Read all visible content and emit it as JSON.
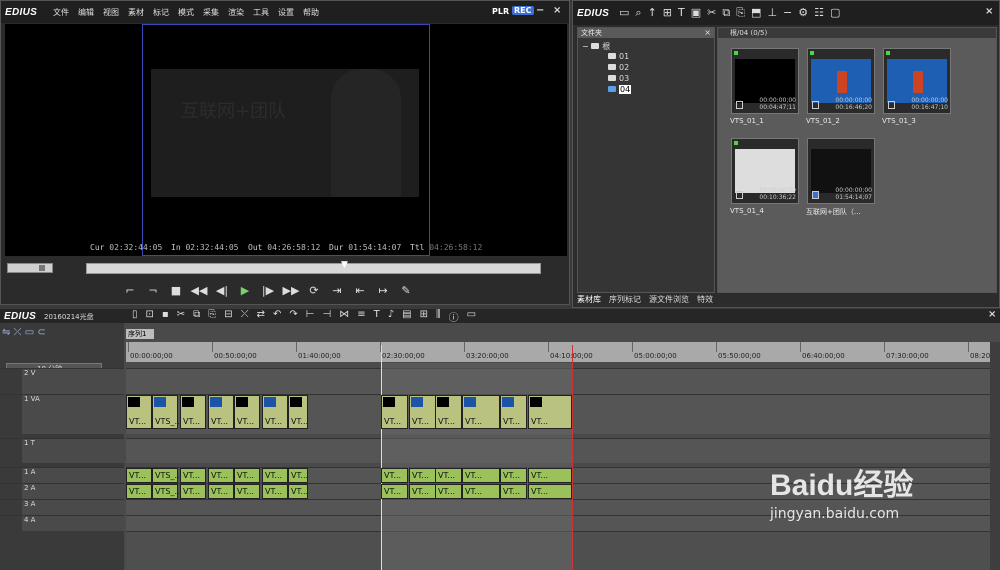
{
  "app": {
    "name": "EDIUS"
  },
  "player": {
    "menu": [
      "文件",
      "编辑",
      "视图",
      "素材",
      "标记",
      "模式",
      "采集",
      "渲染",
      "工具",
      "设置",
      "帮助"
    ],
    "plr": "PLR",
    "rec": "REC",
    "timecodes": {
      "cur_label": "Cur",
      "cur": "02:32:44:05",
      "in_label": "In",
      "in": "02:32:44:05",
      "out_label": "Out",
      "out": "04:26:58:12",
      "dur_label": "Dur",
      "dur": "01:54:14:07",
      "ttl_label": "Ttl",
      "ttl": "04:26:58:12"
    },
    "frame_text": "互联网+团队",
    "position": 0.57
  },
  "bin": {
    "folder_header": "文件夹",
    "root": "根",
    "folders": [
      "01",
      "02",
      "03",
      "04"
    ],
    "selected_folder": "04",
    "clip_header": "根/04 (0/5)",
    "clips": [
      {
        "name": "VTS_01_1",
        "tc1": "00:00:00;00",
        "tc2": "00:04:47;11"
      },
      {
        "name": "VTS_01_2",
        "tc1": "00:00:00;00",
        "tc2": "00:16:46;20"
      },
      {
        "name": "VTS_01_3",
        "tc1": "00:00:00;00",
        "tc2": "00:16:47;10"
      },
      {
        "name": "VTS_01_4",
        "tc1": "00:00:00;00",
        "tc2": "00:10:36;22"
      },
      {
        "name": "互联网+团队（…",
        "tc1": "00:00:00;00",
        "tc2": "01:54:14;07"
      }
    ],
    "tabs": [
      "素材库",
      "序列标记",
      "源文件浏览",
      "特效"
    ]
  },
  "timeline": {
    "project": "20160214光盘",
    "sequence_tab": "序列1",
    "zoom": "10 分钟",
    "ruler": [
      "00:00:00;00",
      "00:50:00;00",
      "01:40:00;00",
      "02:30:00;00",
      "03:20:00;00",
      "04:10:00;00",
      "05:00:00;00",
      "05:50:00;00",
      "06:40:00;00",
      "07:30:00;00",
      "08:20:00;00"
    ],
    "tracks": [
      "2 V",
      "1 VA",
      "1 T",
      "1 A",
      "2 A",
      "3 A",
      "4 A"
    ],
    "clip_label": "VT...",
    "clip_label_full": "VTS_..."
  },
  "watermark": {
    "brand": "Baidu经验",
    "url": "jingyan.baidu.com"
  }
}
